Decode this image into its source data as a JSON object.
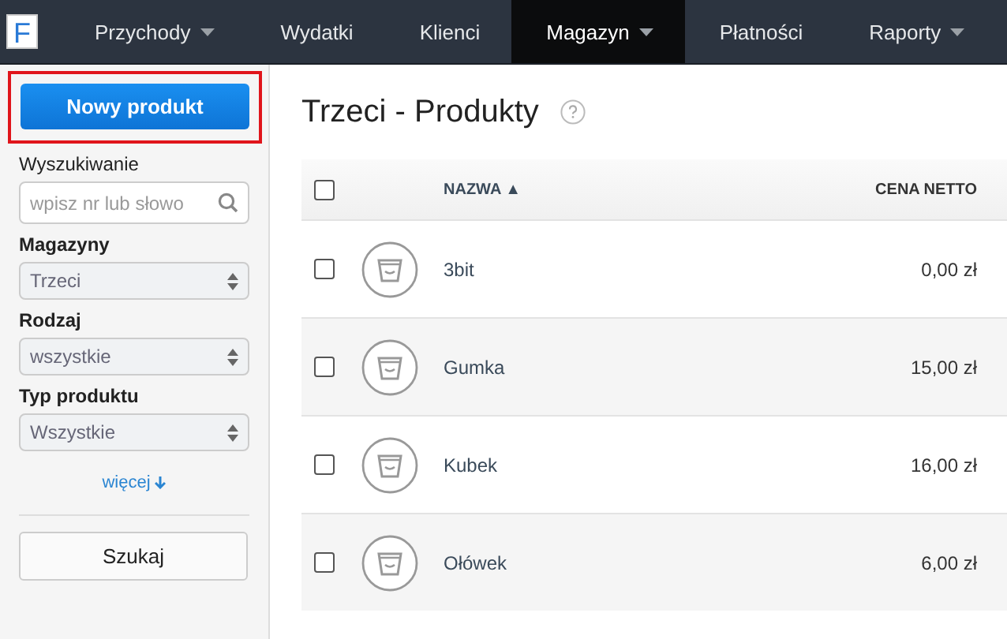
{
  "nav": {
    "logo": "F",
    "items": [
      {
        "label": "Przychody",
        "has_menu": true,
        "selected": false
      },
      {
        "label": "Wydatki",
        "has_menu": false,
        "selected": false
      },
      {
        "label": "Klienci",
        "has_menu": false,
        "selected": false
      },
      {
        "label": "Magazyn",
        "has_menu": true,
        "selected": true
      },
      {
        "label": "Płatności",
        "has_menu": false,
        "selected": false
      },
      {
        "label": "Raporty",
        "has_menu": true,
        "selected": false
      }
    ]
  },
  "sidebar": {
    "new_button": "Nowy produkt",
    "search": {
      "label": "Wyszukiwanie",
      "placeholder": "wpisz nr lub słowo"
    },
    "filters": [
      {
        "label": "Magazyny",
        "value": "Trzeci"
      },
      {
        "label": "Rodzaj",
        "value": "wszystkie"
      },
      {
        "label": "Typ produktu",
        "value": "Wszystkie"
      }
    ],
    "more_link": "więcej",
    "submit_button": "Szukaj"
  },
  "main": {
    "title": "Trzeci - Produkty",
    "table": {
      "header_checked": false,
      "columns": [
        "NAZWA ▲",
        "CENA NETTO"
      ],
      "rows": [
        {
          "checked": false,
          "name": "3bit",
          "price": "0,00 zł"
        },
        {
          "checked": false,
          "name": "Gumka",
          "price": "15,00 zł"
        },
        {
          "checked": false,
          "name": "Kubek",
          "price": "16,00 zł"
        },
        {
          "checked": false,
          "name": "Ołówek",
          "price": "6,00 zł"
        }
      ]
    }
  }
}
